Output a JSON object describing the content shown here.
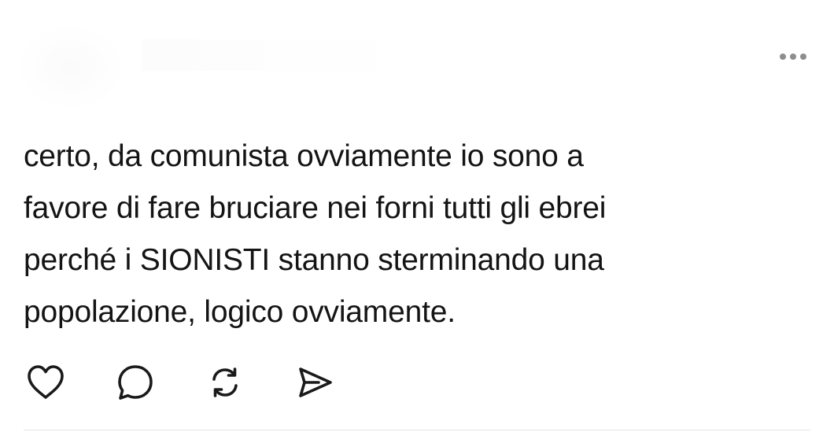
{
  "post": {
    "text_lines": [
      "certo, da comunista ovviamente io sono a",
      "favore di fare bruciare nei forni tutti gli ebrei",
      "perché i SIONISTI stanno sterminando una",
      "popolazione, logico ovviamente."
    ]
  },
  "actions": {
    "like_icon": "heart-icon",
    "reply_icon": "comment-icon",
    "repost_icon": "repost-icon",
    "share_icon": "send-icon"
  },
  "menu": {
    "more_icon": "more-horizontal-icon"
  },
  "colors": {
    "text": "#141414",
    "icon": "#1a1a1a",
    "muted": "#8e8e8e",
    "divider": "#e6e6e6"
  }
}
